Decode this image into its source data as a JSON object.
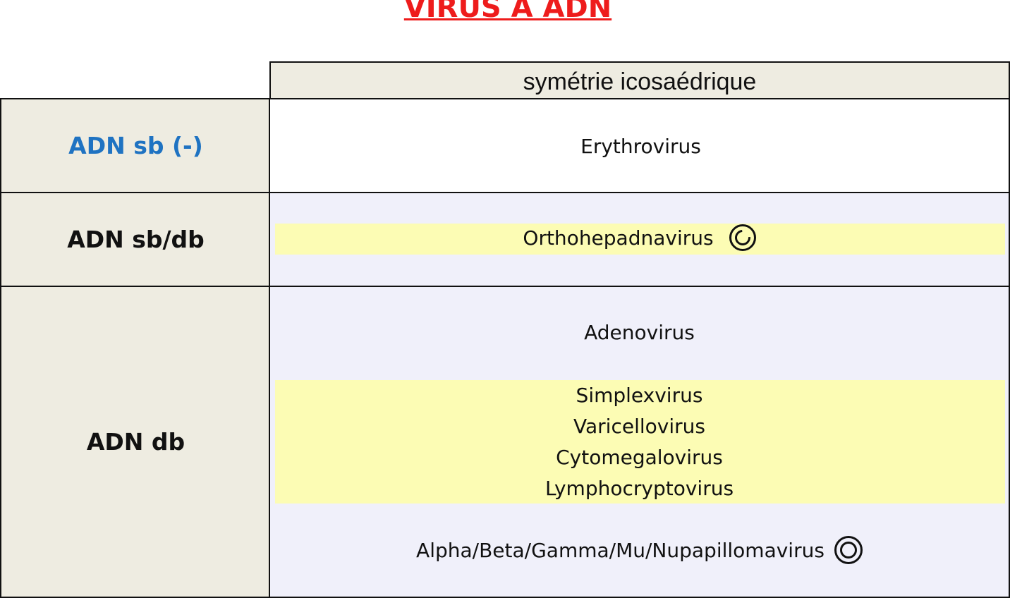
{
  "title": "VIRUS A ADN",
  "header": {
    "symmetry": "symétrie icosaédrique"
  },
  "rows": [
    {
      "label": "ADN sb (-)",
      "label_color": "#1f73c2",
      "viruses": [
        "Erythrovirus"
      ]
    },
    {
      "label": "ADN sb/db",
      "viruses": [
        "Orthohepadnavirus"
      ],
      "marker_icon": "open-circle-icon"
    },
    {
      "label": "ADN db",
      "groups": [
        {
          "viruses": [
            "Adenovirus"
          ]
        },
        {
          "viruses": [
            "Simplexvirus",
            "Varicellovirus",
            "Cytomegalovirus",
            "Lymphocryptovirus"
          ]
        },
        {
          "viruses": [
            "Alpha/Beta/Gamma/Mu/Nupapillomavirus"
          ],
          "marker_icon": "double-circle-icon"
        }
      ]
    }
  ],
  "colors": {
    "title": "#ee1c1c",
    "label_background": "#eeece1",
    "highlight_band": "#fcfcb4",
    "row_tint": "#f0f0fa"
  }
}
